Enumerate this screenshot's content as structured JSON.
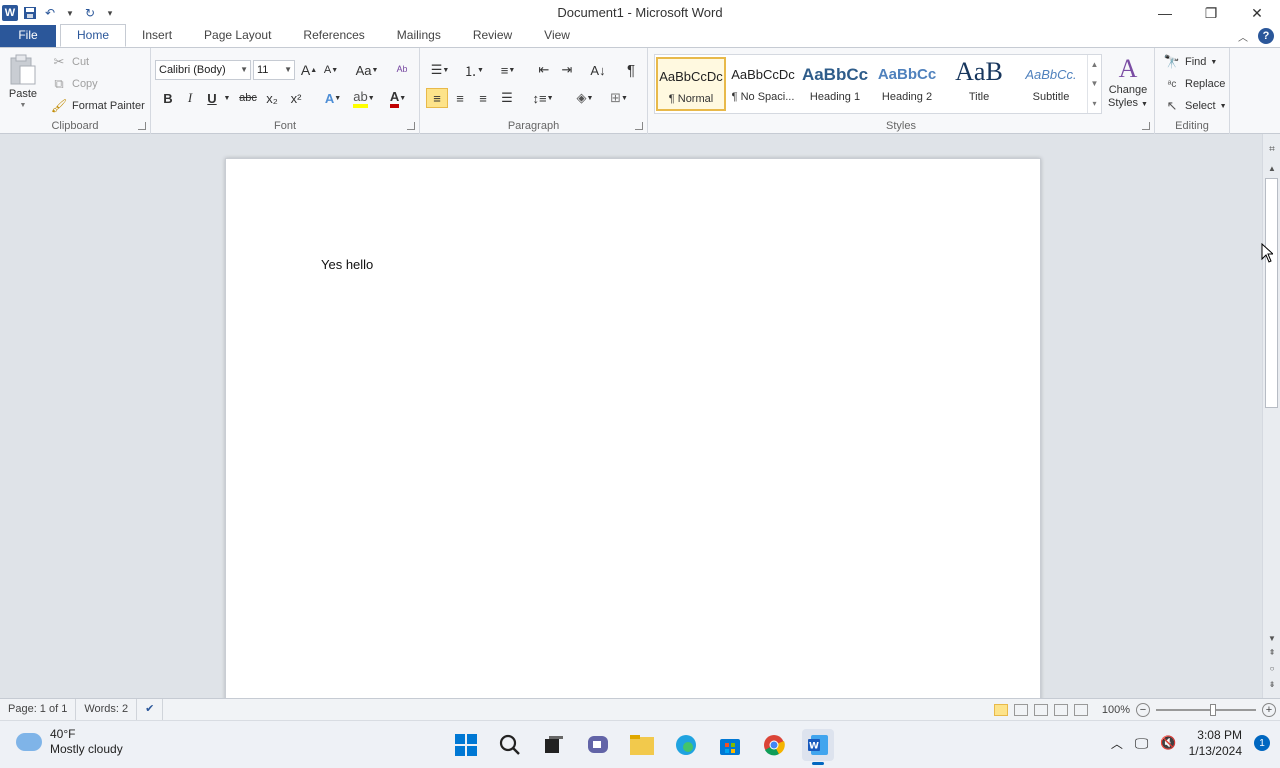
{
  "window": {
    "title": "Document1  -  Microsoft Word",
    "minimize_icon": "minimize-icon",
    "restore_icon": "restore-icon",
    "close_icon": "close-icon"
  },
  "qat": {
    "logo": "W"
  },
  "tabs": [
    {
      "label": "File"
    },
    {
      "label": "Home"
    },
    {
      "label": "Insert"
    },
    {
      "label": "Page Layout"
    },
    {
      "label": "References"
    },
    {
      "label": "Mailings"
    },
    {
      "label": "Review"
    },
    {
      "label": "View"
    }
  ],
  "help": "?",
  "clipboard": {
    "paste": "Paste",
    "cut": "Cut",
    "copy": "Copy",
    "format_painter": "Format Painter",
    "label": "Clipboard"
  },
  "font": {
    "family": "Calibri (Body)",
    "size": "11",
    "label": "Font",
    "bold": "B",
    "italic": "I",
    "underline": "U",
    "strike": "abc",
    "subscript": "x₂",
    "superscript": "x²",
    "grow": "A",
    "shrink": "A",
    "change_case": "Aa",
    "color_a": "A"
  },
  "paragraph": {
    "label": "Paragraph",
    "pilcrow": "¶"
  },
  "styles": {
    "label": "Styles",
    "items": [
      {
        "preview": "AaBbCcDc",
        "name": "¶ Normal"
      },
      {
        "preview": "AaBbCcDc",
        "name": "¶ No Spaci..."
      },
      {
        "preview": "AaBbCc",
        "name": "Heading 1"
      },
      {
        "preview": "AaBbCc",
        "name": "Heading 2"
      },
      {
        "preview": "AaB",
        "name": "Title"
      },
      {
        "preview": "AaBbCc.",
        "name": "Subtitle"
      }
    ],
    "change_styles_line1": "Change",
    "change_styles_line2": "Styles"
  },
  "editing": {
    "label": "Editing",
    "find": "Find",
    "replace": "Replace",
    "select": "Select"
  },
  "document": {
    "text": "Yes hello"
  },
  "status": {
    "page": "Page: 1 of 1",
    "words": "Words: 2",
    "zoom": "100%"
  },
  "taskbar": {
    "temp": "40°F",
    "weather": "Mostly cloudy",
    "time": "3:08 PM",
    "date": "1/13/2024",
    "notifications": "1"
  },
  "colors": {
    "accent": "#2b579a",
    "highlight": "#fde38a",
    "font_color": "#c00000"
  }
}
